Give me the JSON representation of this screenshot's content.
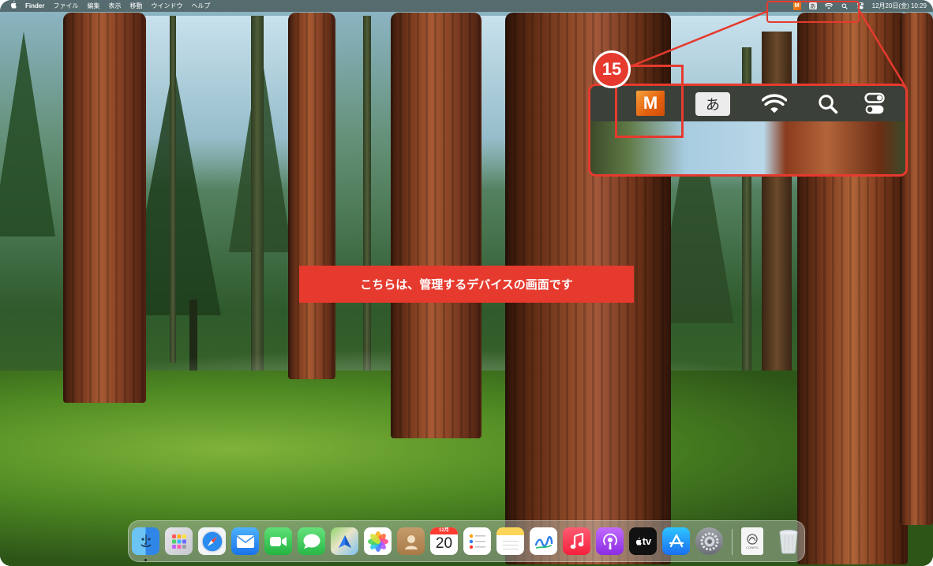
{
  "menubar": {
    "apple": "",
    "app_name": "Finder",
    "menus": [
      "ファイル",
      "編集",
      "表示",
      "移動",
      "ウインドウ",
      "ヘルプ"
    ],
    "status_m": "M",
    "status_input": "あ",
    "datetime": "12月20日(金)  10:29"
  },
  "callout": {
    "number": "15",
    "m_icon_letter": "M",
    "input_icon": "あ",
    "icons": [
      "m-app-icon",
      "input-method-icon",
      "wifi-icon",
      "spotlight-search-icon",
      "control-center-icon"
    ]
  },
  "banner": {
    "text": "こちらは、管理するデバイスの画面です"
  },
  "dock": {
    "items": [
      "finder",
      "launchpad",
      "safari",
      "mail",
      "facetime",
      "messages",
      "maps",
      "photos",
      "contacts",
      "calendar",
      "reminders",
      "notes",
      "freeform",
      "music",
      "podcasts",
      "apple-tv",
      "app-store",
      "system-settings",
      "document",
      "trash"
    ],
    "calendar_month": "12月",
    "calendar_day": "20",
    "tv_label": "tv",
    "document_label": "CONFIG"
  },
  "colors": {
    "highlight": "#e63a2e",
    "m_icon": "#e3600e"
  }
}
